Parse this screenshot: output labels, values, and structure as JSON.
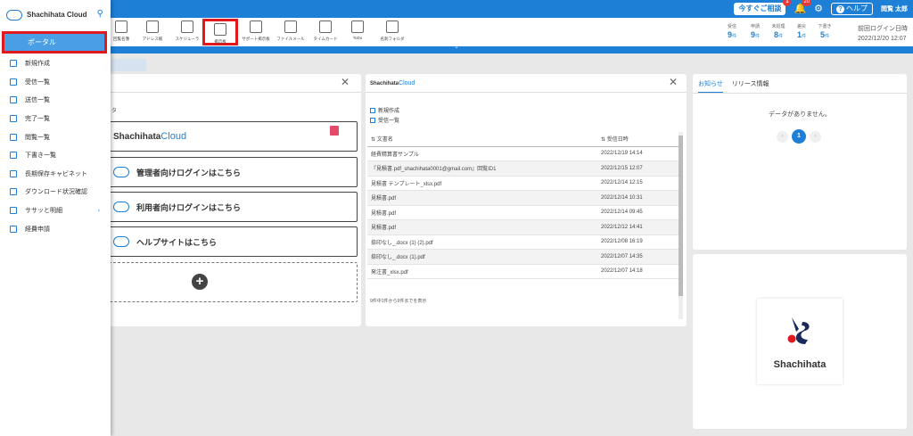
{
  "app": {
    "brand": "Shachihata Cloud",
    "brand_text": "Shachihata",
    "brand_cloud": "Cloud"
  },
  "topbar": {
    "soon_consult": "今すぐご相談",
    "soon_badge": "1",
    "bell_badge": "20",
    "help_label": "ヘルプ",
    "user": "閲覧 太郎"
  },
  "toolbar": {
    "items": [
      {
        "label": "回覧名簿",
        "icon": "book-icon"
      },
      {
        "label": "アドレス帳",
        "icon": "address-book-icon"
      },
      {
        "label": "スケジューラ",
        "icon": "calendar-icon"
      },
      {
        "label": "掲示板",
        "icon": "board-icon"
      },
      {
        "label": "サポート掲示板",
        "icon": "support-board-icon"
      },
      {
        "label": "ファイルメール",
        "icon": "file-mail-icon"
      },
      {
        "label": "タイムカード",
        "icon": "timecard-icon"
      },
      {
        "label": "ToDo",
        "icon": "todo-icon"
      },
      {
        "label": "名刺フォルダ",
        "icon": "card-folder-icon"
      }
    ],
    "stats": [
      {
        "label": "受信",
        "value": "9",
        "unit": "件"
      },
      {
        "label": "申請",
        "value": "9",
        "unit": "件"
      },
      {
        "label": "未処理",
        "value": "8",
        "unit": "件"
      },
      {
        "label": "差戻",
        "value": "1",
        "unit": "件"
      },
      {
        "label": "下書き",
        "value": "5",
        "unit": "件"
      }
    ],
    "last_login_label": "前回ログイン日時",
    "last_login_value": "2022/12/20 12:07"
  },
  "sidebar": {
    "active": "ポータル",
    "items": [
      {
        "label": "新規作成"
      },
      {
        "label": "受信一覧"
      },
      {
        "label": "送信一覧"
      },
      {
        "label": "完了一覧"
      },
      {
        "label": "閲覧一覧"
      },
      {
        "label": "下書き一覧"
      },
      {
        "label": "長期保存キャビネット"
      },
      {
        "label": "ダウンロード状況確認"
      },
      {
        "label": "ササッと明細",
        "arrow": "›"
      },
      {
        "label": "経費申請"
      }
    ]
  },
  "tabstrip": "",
  "panel1": {
    "label": "タ",
    "links": [
      {
        "label": "管理者向けログインはこちら"
      },
      {
        "label": "利用者向けログインはこちら"
      },
      {
        "label": "ヘルプサイトはこちら"
      }
    ]
  },
  "panel2": {
    "new_label": "新規作成",
    "inbox_label": "受信一覧",
    "col_name": "文書名",
    "col_date": "受信日時",
    "rows": [
      {
        "name": "経費精算書サンプル",
        "date": "2022/12/19 14:14"
      },
      {
        "name": "『見積書.pdf_shachihata0001@gmail.com』回覧ID1",
        "date": "2022/12/15 12:07"
      },
      {
        "name": "見積書 テンプレート_xlsx.pdf",
        "date": "2022/12/14 12:15"
      },
      {
        "name": "見積書.pdf",
        "date": "2022/12/14 10:31"
      },
      {
        "name": "見積書.pdf",
        "date": "2022/12/14 09:45"
      },
      {
        "name": "見積書.pdf",
        "date": "2022/12/12 14:41"
      },
      {
        "name": "捺印なし_.docx (1) (2).pdf",
        "date": "2022/12/08 16:19"
      },
      {
        "name": "捺印なし_.docx (1).pdf",
        "date": "2022/12/07 14:35"
      },
      {
        "name": "発注書_xlsx.pdf",
        "date": "2022/12/07 14:18"
      }
    ],
    "info": "9件中1件から9件までを表示"
  },
  "panel3": {
    "tab_notice": "お知らせ",
    "tab_release": "リリース情報",
    "nodata": "データがありません。",
    "page": "1",
    "prev": "‹",
    "next": "›"
  },
  "panel4": {
    "logo_text": "Shachihata"
  },
  "colors": {
    "primary": "#1e7fd6",
    "highlight": "#e0191f"
  }
}
